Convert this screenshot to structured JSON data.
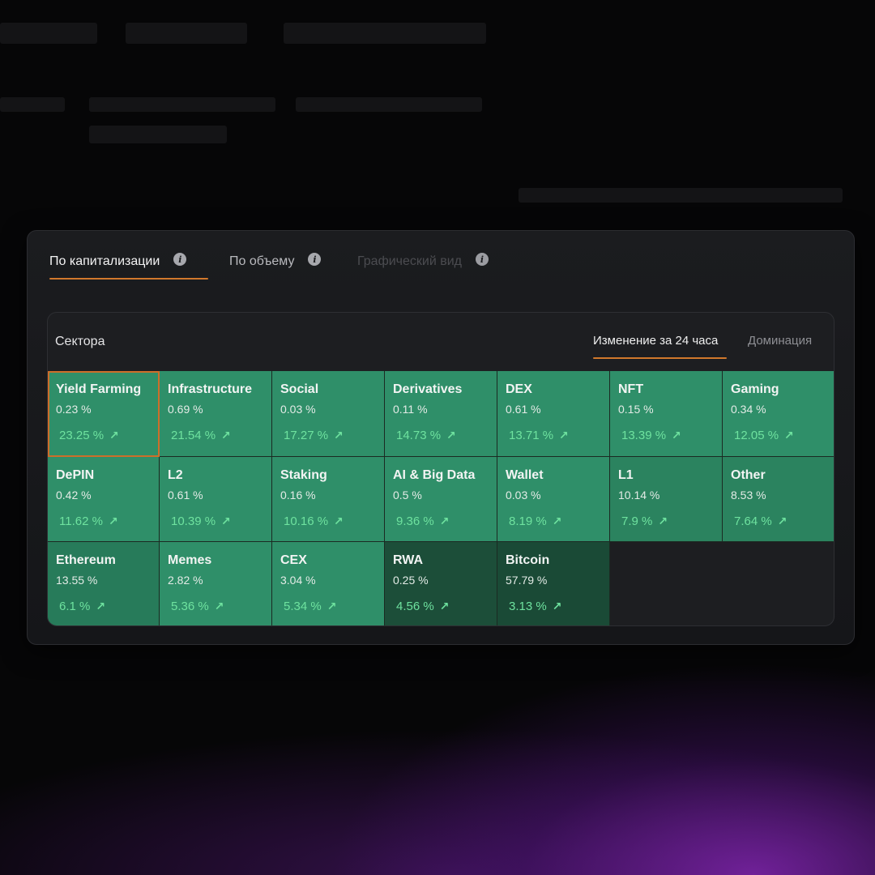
{
  "tabs": [
    {
      "label": "По капитализации",
      "active": true
    },
    {
      "label": "По объему",
      "active": false
    },
    {
      "label": "Графический вид",
      "active": false
    }
  ],
  "panel": {
    "title": "Сектора",
    "subtabs": [
      {
        "label": "Изменение за 24 часа",
        "active": true
      },
      {
        "label": "Доминация",
        "active": false
      }
    ]
  },
  "colors": {
    "accent": "#d1782c",
    "tile_bright": "#2f8f69",
    "tile_mid": "#277b5a",
    "tile_dark": "#1a4a36",
    "positive": "#6ee29f"
  },
  "icons": {
    "info": "info-icon",
    "trend": "arrow-up-right-icon"
  },
  "sectors": [
    {
      "name": "Yield Farming",
      "share": "0.23 %",
      "change": "23.25 %",
      "color": "#2f8f69",
      "selected": true
    },
    {
      "name": "Infrastructure",
      "share": "0.69 %",
      "change": "21.54 %",
      "color": "#2f8f69"
    },
    {
      "name": "Social",
      "share": "0.03 %",
      "change": "17.27 %",
      "color": "#2f8f69"
    },
    {
      "name": "Derivatives",
      "share": "0.11 %",
      "change": "14.73 %",
      "color": "#2f8f69"
    },
    {
      "name": "DEX",
      "share": "0.61 %",
      "change": "13.71 %",
      "color": "#2f8f69"
    },
    {
      "name": "NFT",
      "share": "0.15 %",
      "change": "13.39 %",
      "color": "#2f8f69"
    },
    {
      "name": "Gaming",
      "share": "0.34 %",
      "change": "12.05 %",
      "color": "#2f8f69"
    },
    {
      "name": "DePIN",
      "share": "0.42 %",
      "change": "11.62 %",
      "color": "#2f8f69"
    },
    {
      "name": "L2",
      "share": "0.61 %",
      "change": "10.39 %",
      "color": "#2f8f69"
    },
    {
      "name": "Staking",
      "share": "0.16 %",
      "change": "10.16 %",
      "color": "#2f8f69"
    },
    {
      "name": "AI & Big Data",
      "share": "0.5 %",
      "change": "9.36 %",
      "color": "#2f8f69"
    },
    {
      "name": "Wallet",
      "share": "0.03 %",
      "change": "8.19 %",
      "color": "#2f8f69"
    },
    {
      "name": "L1",
      "share": "10.14 %",
      "change": "7.9 %",
      "color": "#2b835f"
    },
    {
      "name": "Other",
      "share": "8.53 %",
      "change": "7.64 %",
      "color": "#2b835f"
    },
    {
      "name": "Ethereum",
      "share": "13.55 %",
      "change": "6.1 %",
      "color": "#277b5a"
    },
    {
      "name": "Memes",
      "share": "2.82 %",
      "change": "5.36 %",
      "color": "#2f8f69"
    },
    {
      "name": "CEX",
      "share": "3.04 %",
      "change": "5.34 %",
      "color": "#2f8f69"
    },
    {
      "name": "RWA",
      "share": "0.25 %",
      "change": "4.56 %",
      "color": "#1c4e39"
    },
    {
      "name": "Bitcoin",
      "share": "57.79 %",
      "change": "3.13 %",
      "color": "#1a4a36"
    }
  ]
}
